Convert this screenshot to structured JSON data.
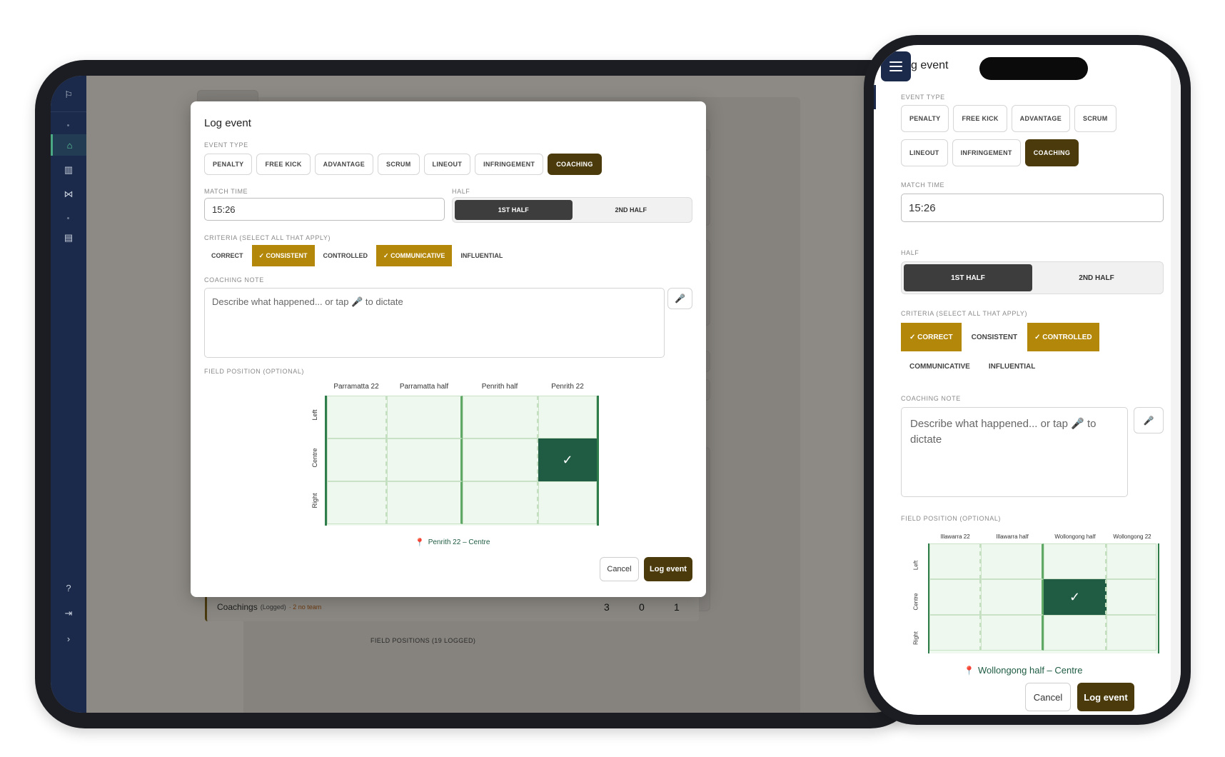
{
  "tablet": {
    "sidebar": {
      "items": [
        {
          "icon": "whistle-icon",
          "glyph": "⚐"
        },
        {
          "icon": "home-icon",
          "glyph": "⌂"
        },
        {
          "icon": "bar-chart-icon",
          "glyph": "▥"
        },
        {
          "icon": "share-icon",
          "glyph": "⋈"
        },
        {
          "icon": "document-icon",
          "glyph": "▤"
        },
        {
          "icon": "help-icon",
          "glyph": "?"
        },
        {
          "icon": "logout-icon",
          "glyph": "⇥"
        },
        {
          "icon": "chevron-right-icon",
          "glyph": "›"
        }
      ]
    },
    "background": {
      "row_label": "Coachings",
      "row_logged": "(Logged)",
      "row_warning": "· 2 no team",
      "row_values": [
        "3",
        "0",
        "1"
      ],
      "footer": "FIELD POSITIONS (19 LOGGED)"
    },
    "modal": {
      "title": "Log event",
      "event_type_label": "EVENT TYPE",
      "event_types": [
        "PENALTY",
        "FREE KICK",
        "ADVANTAGE",
        "SCRUM",
        "LINEOUT",
        "INFRINGEMENT",
        "COACHING"
      ],
      "selected_event": "COACHING",
      "match_time_label": "MATCH TIME",
      "match_time_value": "15:26",
      "half_label": "HALF",
      "halves": [
        "1ST HALF",
        "2ND HALF"
      ],
      "selected_half": "1ST HALF",
      "criteria_label": "CRITERIA (SELECT ALL THAT APPLY)",
      "criteria": [
        {
          "label": "CORRECT",
          "on": false
        },
        {
          "label": "✓ CONSISTENT",
          "on": true
        },
        {
          "label": "CONTROLLED",
          "on": false
        },
        {
          "label": "✓ COMMUNICATIVE",
          "on": true
        },
        {
          "label": "INFLUENTIAL",
          "on": false
        }
      ],
      "note_label": "COACHING NOTE",
      "note_placeholder": "Describe what happened... or tap 🎤 to dictate",
      "mic_glyph": "🎤",
      "field_label": "FIELD POSITION (OPTIONAL)",
      "columns": [
        "Parramatta 22",
        "Parramatta half",
        "Penrith half",
        "Penrith 22"
      ],
      "rows": [
        "Left",
        "Centre",
        "Right"
      ],
      "selected_cell": {
        "row": 1,
        "col": 3
      },
      "check_glyph": "✓",
      "position_caption": "Penrith 22 – Centre",
      "cancel_label": "Cancel",
      "submit_label": "Log event"
    }
  },
  "phone": {
    "title": "g event",
    "event_type_label": "EVENT TYPE",
    "event_types_row1": [
      "PENALTY",
      "FREE KICK",
      "ADVANTAGE",
      "SCRUM"
    ],
    "event_types_row2": [
      "LINEOUT",
      "INFRINGEMENT",
      "COACHING"
    ],
    "selected_event": "COACHING",
    "match_time_label": "MATCH TIME",
    "match_time_value": "15:26",
    "half_label": "HALF",
    "halves": [
      "1ST HALF",
      "2ND HALF"
    ],
    "selected_half": "1ST HALF",
    "criteria_label": "CRITERIA (SELECT ALL THAT APPLY)",
    "criteria_row1": [
      {
        "label": "✓ CORRECT",
        "on": true
      },
      {
        "label": "CONSISTENT",
        "on": false
      },
      {
        "label": "✓ CONTROLLED",
        "on": true
      }
    ],
    "criteria_row2": [
      {
        "label": "COMMUNICATIVE",
        "on": false
      },
      {
        "label": "INFLUENTIAL",
        "on": false
      }
    ],
    "note_label": "COACHING NOTE",
    "note_placeholder": "Describe what happened... or tap 🎤 to dictate",
    "mic_glyph": "🎤",
    "field_label": "FIELD POSITION (OPTIONAL)",
    "columns": [
      "Illawarra 22",
      "Illawarra half",
      "Wollongong half",
      "Wollongong 22"
    ],
    "rows": [
      "Left",
      "Centre",
      "Right"
    ],
    "selected_cell": {
      "row": 1,
      "col": 2
    },
    "check_glyph": "✓",
    "position_caption": "Wollongong half – Centre",
    "cancel_label": "Cancel",
    "submit_label": "Log event"
  },
  "colors": {
    "navy": "#1b2a4a",
    "brown_primary": "#4a3a0c",
    "gold_selected": "#b38709",
    "field_green": "#1f5c43"
  }
}
